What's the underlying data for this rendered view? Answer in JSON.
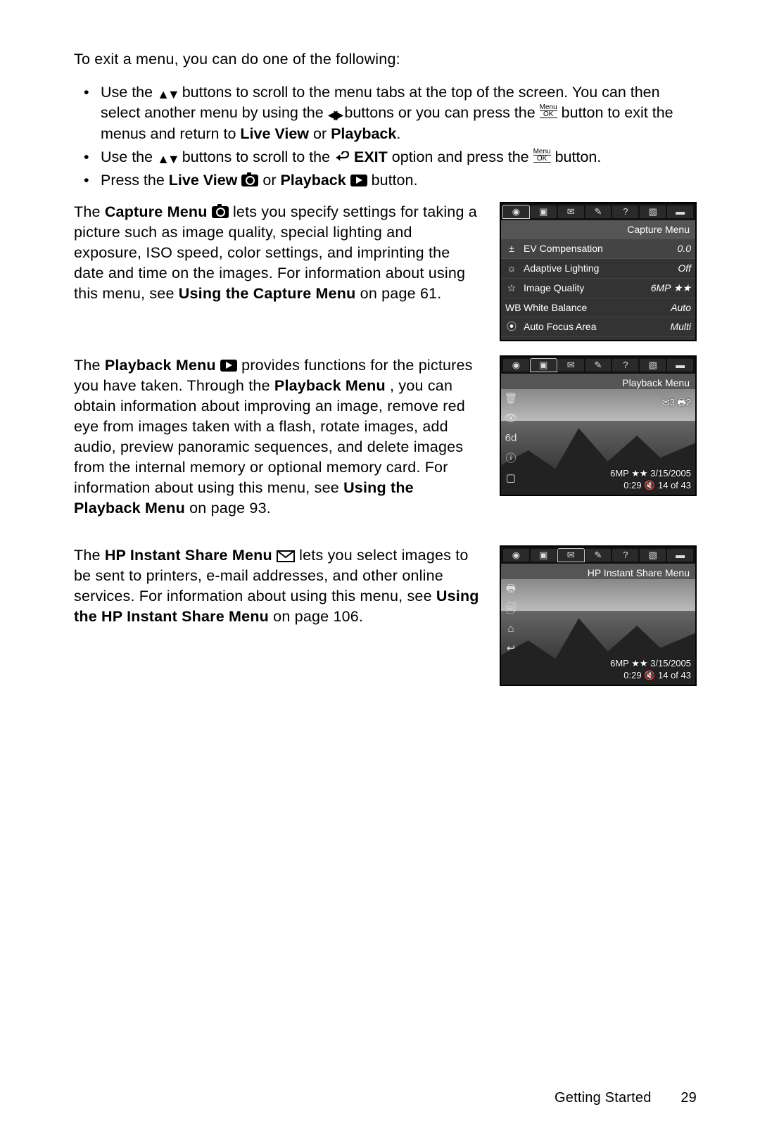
{
  "intro": "To exit a menu, you can do one of the following:",
  "bullets": {
    "b1a": "Use the ",
    "b1b": " buttons to scroll to the menu tabs at the top of the screen. You can then select another menu by using the ",
    "b1c": " buttons or you can press the ",
    "b1d": " button to exit the menus and return to ",
    "b1e": " or ",
    "liveview": "Live View",
    "playback": "Playback",
    "period": ".",
    "b2a": "Use the ",
    "b2b": " buttons to scroll to the ",
    "b2c": " option and press the ",
    "b2d": " button.",
    "exit": "EXIT",
    "b3a": "Press the ",
    "b3b": " or ",
    "b3c": " button."
  },
  "capture": {
    "pre": "The ",
    "title": "Capture Menu",
    "body1": " lets you specify settings for taking a picture such as image quality, special lighting and exposure, ISO speed, color settings, and imprinting the date and time on the images. For information about using this menu, see ",
    "ref": "Using the Capture Menu",
    "body2": " on page 61."
  },
  "playbackBlock": {
    "pre": "The ",
    "title": "Playback Menu",
    "body1": " provides functions for the pictures you have taken. Through the ",
    "title2": "Playback Menu",
    "body2": ", you can obtain information about improving an image, remove red eye from images taken with a flash, rotate images, add audio, preview panoramic sequences, and delete images from the internal memory or optional memory card. For information about using this menu, see ",
    "ref": "Using the Playback Menu",
    "body3": " on page 93."
  },
  "share": {
    "pre": "The ",
    "title": "HP Instant Share Menu",
    "body1": " lets you select images to be sent to printers, e-mail addresses, and other online services. For information about using this menu, see ",
    "ref": "Using the HP Instant Share Menu",
    "body2": " on page 106."
  },
  "screen1": {
    "title": "Capture Menu",
    "rows": [
      {
        "icon": "±",
        "label": "EV Compensation",
        "val": "0.0"
      },
      {
        "icon": "☼",
        "label": "Adaptive Lighting",
        "val": "Off"
      },
      {
        "icon": "☆",
        "label": "Image Quality",
        "val": "6MP ★★"
      },
      {
        "icon": "WB",
        "label": "White Balance",
        "val": "Auto"
      },
      {
        "icon": "⦿",
        "label": "Auto Focus Area",
        "val": "Multi"
      }
    ]
  },
  "screen2": {
    "title": "Playback Menu",
    "mini": {
      "a": "✉3",
      "b": "🖶2"
    },
    "line1": "6MP ★★  3/15/2005",
    "line2": "0:29 🔇    14 of 43"
  },
  "screen3": {
    "title": "HP Instant Share Menu",
    "line1": "6MP ★★  3/15/2005",
    "line2": "0:29 🔇    14 of 43"
  },
  "footer": {
    "section": "Getting Started",
    "page": "29"
  }
}
